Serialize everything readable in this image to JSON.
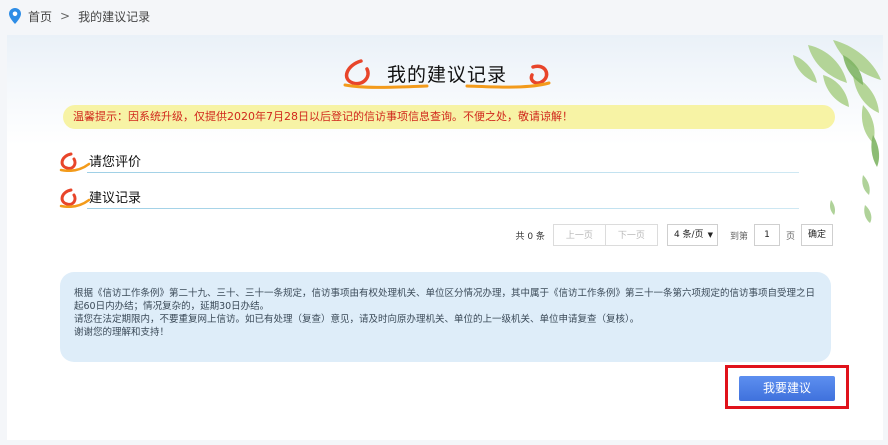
{
  "breadcrumb": {
    "home": "首页",
    "separator": ">",
    "current": "我的建议记录"
  },
  "page_title": "我的建议记录",
  "notice": "温馨提示：因系统升级，仅提供2020年7月28日以后登记的信访事项信息查询。不便之处，敬请谅解！",
  "sections": {
    "rate": "请您评价",
    "records": "建议记录"
  },
  "pagination": {
    "total": "共 0 条",
    "prev": "上一页",
    "next": "下一页",
    "page_size": "4 条/页",
    "goto_prefix": "到第",
    "goto_value": "1",
    "goto_suffix": "页",
    "confirm": "确定"
  },
  "info": {
    "line1": "根据《信访工作条例》第二十九、三十、三十一条规定，信访事项由有权处理机关、单位区分情况办理，其中属于《信访工作条例》第三十一条第六项规定的信访事项自受理之日起60日内办结；情况复杂的，延期30日办结。",
    "line2": "请您在法定期限内，不要重复网上信访。如已有处理（复查）意见，请及时向原办理机关、单位的上一级机关、单位申请复查（复核）。",
    "line3": "谢谢您的理解和支持！"
  },
  "suggest_button": "我要建议",
  "colors": {
    "accent_blue": "#3f71dc",
    "notice_bg": "#f7f3a5",
    "notice_text": "#d0281c",
    "info_bg": "#deedf9",
    "highlight_red": "#e0121b",
    "swirl_red": "#e8452a",
    "swirl_orange": "#f39b1b"
  },
  "icons": {
    "breadcrumb": "location-pin-icon",
    "section": "swirl-icon",
    "dropdown": "triangle-down-icon"
  }
}
